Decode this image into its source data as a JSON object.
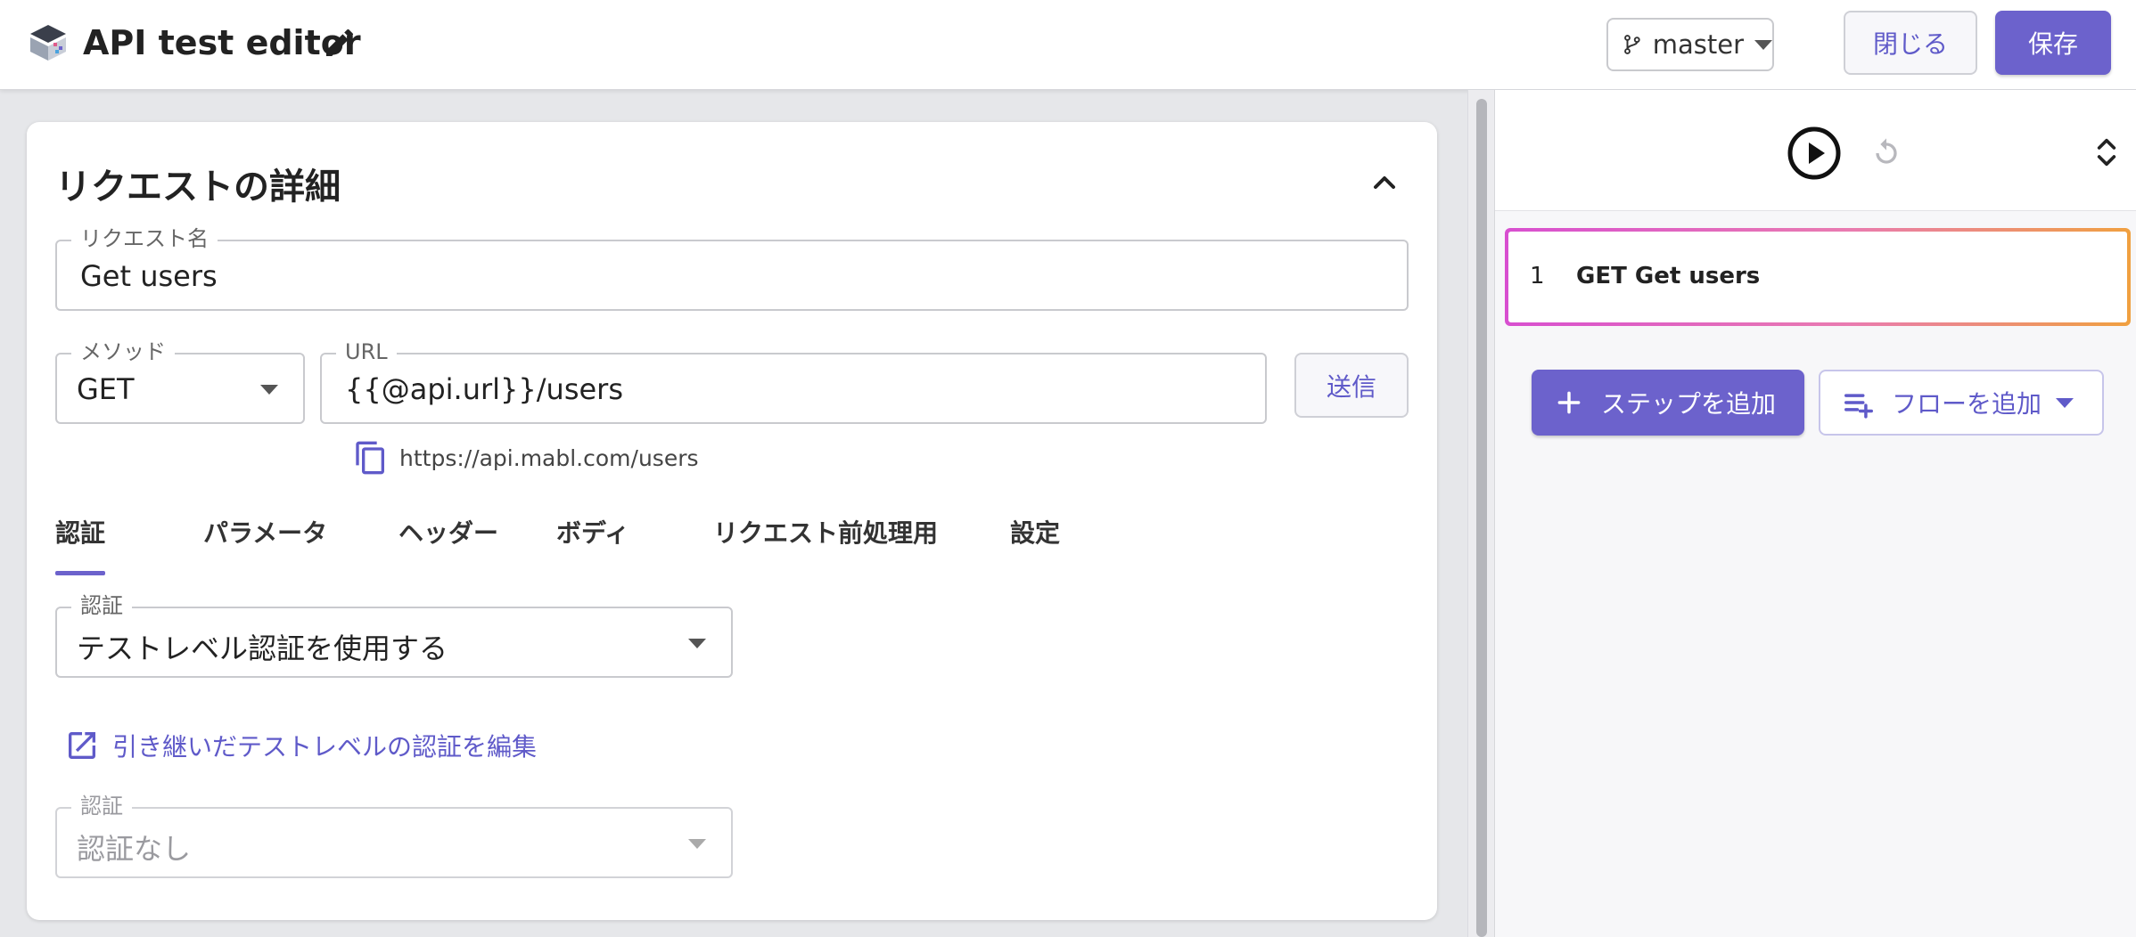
{
  "header": {
    "app_title": "API test editor",
    "branch": "master",
    "close_label": "閉じる",
    "save_label": "保存"
  },
  "request": {
    "section_title": "リクエストの詳細",
    "name_label": "リクエスト名",
    "name_value": "Get users",
    "method_label": "メソッド",
    "method_value": "GET",
    "url_label": "URL",
    "url_value": "{{@api.url}}/users",
    "send_label": "送信",
    "resolved_url": "https://api.mabl.com/users"
  },
  "tabs": [
    {
      "label": "認証",
      "active": true
    },
    {
      "label": "パラメータ",
      "active": false
    },
    {
      "label": "ヘッダー",
      "active": false
    },
    {
      "label": "ボディ",
      "active": false
    },
    {
      "label": "リクエスト前処理用",
      "active": false
    },
    {
      "label": "設定",
      "active": false
    }
  ],
  "auth": {
    "label": "認証",
    "value": "テストレベル認証を使用する",
    "edit_link": "引き継いだテストレベルの認証を編集",
    "inherited_label": "認証",
    "inherited_value": "認証なし"
  },
  "steps_panel": {
    "steps": [
      {
        "number": "1",
        "label": "GET Get users"
      }
    ],
    "add_step_label": "ステップを追加",
    "add_flow_label": "フローを追加"
  },
  "colors": {
    "accent": "#6c62cc",
    "link": "#5f5ac9",
    "step_border_gradient": [
      "#d84fd0",
      "#f0a040"
    ]
  },
  "icons": {
    "logo": "mabl-logo-icon",
    "edit": "pencil-icon",
    "branch": "git-branch-icon",
    "collapse": "chevron-up-icon",
    "copy": "copy-icon",
    "open_external": "open-in-new-icon",
    "run": "play-circle-icon",
    "reset": "restart-icon",
    "expand": "unfold-icon",
    "add": "plus-icon",
    "playlist_add": "playlist-add-icon"
  }
}
